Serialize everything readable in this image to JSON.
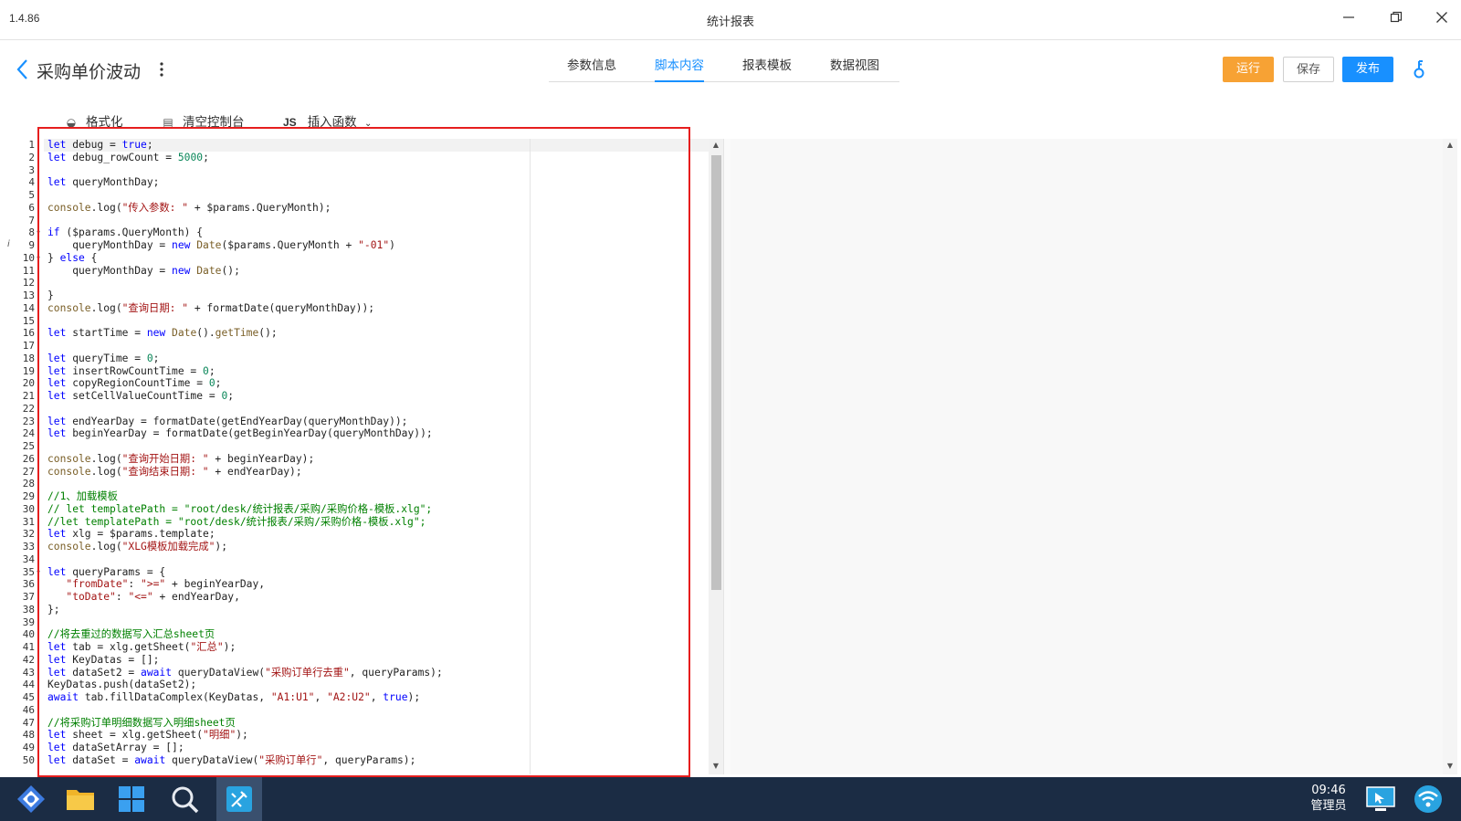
{
  "window": {
    "version": "1.4.86",
    "title": "统计报表"
  },
  "header": {
    "page_title": "采购单价波动",
    "tabs": [
      {
        "label": "参数信息"
      },
      {
        "label": "脚本内容"
      },
      {
        "label": "报表模板"
      },
      {
        "label": "数据视图"
      }
    ],
    "run_label": "运行",
    "save_label": "保存",
    "publish_label": "发布"
  },
  "toolbar": {
    "format_label": "格式化",
    "clear_console_label": "清空控制台",
    "js_label": "JS",
    "insert_function_label": "插入函数"
  },
  "editor": {
    "lines": [
      "let debug = true;",
      "let debug_rowCount = 5000;",
      "",
      "let queryMonthDay;",
      "",
      "console.log(\"传入参数: \" + $params.QueryMonth);",
      "",
      "if ($params.QueryMonth) {",
      "    queryMonthDay = new Date($params.QueryMonth + \"-01\")",
      "} else {",
      "    queryMonthDay = new Date();",
      "",
      "}",
      "console.log(\"查询日期: \" + formatDate(queryMonthDay));",
      "",
      "let startTime = new Date().getTime();",
      "",
      "let queryTime = 0;",
      "let insertRowCountTime = 0;",
      "let copyRegionCountTime = 0;",
      "let setCellValueCountTime = 0;",
      "",
      "let endYearDay = formatDate(getEndYearDay(queryMonthDay));",
      "let beginYearDay = formatDate(getBeginYearDay(queryMonthDay));",
      "",
      "console.log(\"查询开始日期: \" + beginYearDay);",
      "console.log(\"查询结束日期: \" + endYearDay);",
      "",
      "//1、加载模板",
      "// let templatePath = \"root/desk/统计报表/采购/采购价格-模板.xlg\";",
      "//let templatePath = \"root/desk/统计报表/采购/采购价格-模板.xlg\";",
      "let xlg = $params.template;",
      "console.log(\"XLG模板加载完成\");",
      "",
      "let queryParams = {",
      "   \"fromDate\": \">=\" + beginYearDay,",
      "   \"toDate\": \"<=\" + endYearDay,",
      "};",
      "",
      "//将去重过的数据写入汇总sheet页",
      "let tab = xlg.getSheet(\"汇总\");",
      "let KeyDatas = [];",
      "let dataSet2 = await queryDataView(\"采购订单行去重\", queryParams);",
      "KeyDatas.push(dataSet2);",
      "await tab.fillDataComplex(KeyDatas, \"A1:U1\", \"A2:U2\", true);",
      "",
      "//将采购订单明细数据写入明细sheet页",
      "let sheet = xlg.getSheet(\"明细\");",
      "let dataSetArray = [];",
      "let dataSet = await queryDataView(\"采购订单行\", queryParams);"
    ]
  },
  "taskbar": {
    "time": "09:46",
    "user": "管理员"
  },
  "colors": {
    "accent": "#1890ff",
    "run": "#f7a234",
    "highlight_box": "#e61e1e",
    "taskbar": "#1b2c44"
  },
  "icons": [
    "back-chevron-icon",
    "more-vertical-icon",
    "minimize-icon",
    "restore-icon",
    "close-icon",
    "help-key-icon",
    "format-icon",
    "clear-console-icon",
    "dropdown-chevron-icon",
    "start-icon",
    "folder-icon",
    "windows-icon",
    "search-icon",
    "design-tool-icon",
    "remote-desktop-icon",
    "network-icon"
  ]
}
